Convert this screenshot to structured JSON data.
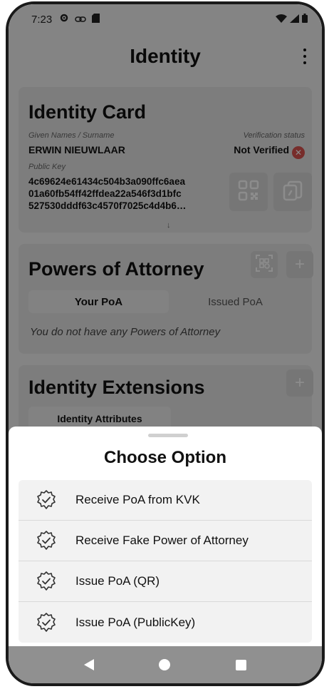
{
  "status_bar": {
    "time": "7:23"
  },
  "app_bar": {
    "title": "Identity"
  },
  "identity_card": {
    "title": "Identity Card",
    "name_label": "Given Names / Surname",
    "name_value": "ERWIN NIEUWLAAR",
    "verification_label": "Verification status",
    "verification_value": "Not Verified",
    "public_key_label": "Public Key",
    "public_key_lines": [
      "4c69624e61434c504b3a090ffc6aea",
      "01a60fb54ff42ffdea22a546f3d1bfc",
      "527530dddf63c4570f7025c4d4b6…"
    ],
    "expand_glyph": "↓"
  },
  "powers_of_attorney": {
    "title": "Powers of Attorney",
    "tabs": [
      "Your PoA",
      "Issued PoA"
    ],
    "empty_text": "You do not have any Powers of Attorney",
    "add_glyph": "+"
  },
  "identity_extensions": {
    "title": "Identity Extensions",
    "attributes_button": "Identity Attributes",
    "add_glyph": "+"
  },
  "sheet": {
    "title": "Choose Option",
    "options": [
      {
        "label": "Receive PoA from KVK",
        "icon": "verified-badge-icon"
      },
      {
        "label": "Receive Fake Power of Attorney",
        "icon": "verified-badge-icon"
      },
      {
        "label": "Issue PoA (QR)",
        "icon": "verified-badge-icon"
      },
      {
        "label": "Issue PoA (PublicKey)",
        "icon": "verified-badge-icon"
      }
    ]
  },
  "colors": {
    "overlay": "#000000",
    "not_verified": "#d9534f",
    "nav_bar": "#909090"
  }
}
